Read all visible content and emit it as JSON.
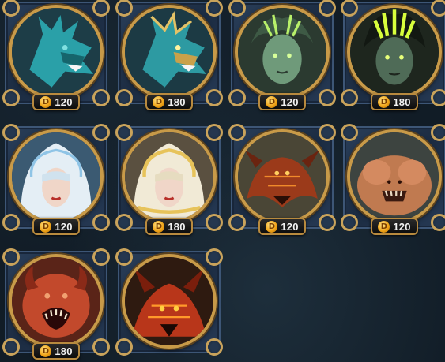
{
  "currency_icon": "gold-coin-icon",
  "currency_symbol": "D",
  "items": [
    {
      "name": "teal-dragon",
      "price": "120",
      "palette": {
        "bg": "#1d3d47",
        "main": "#2aa0a8",
        "accent": "#7fe0e0"
      }
    },
    {
      "name": "teal-gold-dragon",
      "price": "180",
      "palette": {
        "bg": "#1c3a44",
        "main": "#2d9aa2",
        "accent": "#e3c266"
      }
    },
    {
      "name": "green-medusa",
      "price": "120",
      "palette": {
        "bg": "#2b3a30",
        "main": "#6f9a7a",
        "accent": "#b8f06a"
      }
    },
    {
      "name": "dark-medusa",
      "price": "180",
      "palette": {
        "bg": "#1e261e",
        "main": "#4f6b57",
        "accent": "#d8ff3c"
      }
    },
    {
      "name": "white-hooded-priestess",
      "price": "120",
      "palette": {
        "bg": "#3b5a72",
        "main": "#e4eef5",
        "accent": "#8fc4e6"
      }
    },
    {
      "name": "gold-hooded-priestess",
      "price": "180",
      "palette": {
        "bg": "#5a5040",
        "main": "#f1ead6",
        "accent": "#e7c35a"
      }
    },
    {
      "name": "lava-beast",
      "price": "120",
      "palette": {
        "bg": "#4a4636",
        "main": "#9b3a1a",
        "accent": "#f08a2a"
      }
    },
    {
      "name": "flesh-golem",
      "price": "120",
      "palette": {
        "bg": "#3d4440",
        "main": "#c07a50",
        "accent": "#e8a878"
      }
    },
    {
      "name": "red-fiend",
      "price": "180",
      "palette": {
        "bg": "#5a2418",
        "main": "#c2492c",
        "accent": "#f0a070"
      }
    },
    {
      "name": "fire-demon",
      "price": "",
      "palette": {
        "bg": "#2e1a10",
        "main": "#b8361a",
        "accent": "#ff9a2a"
      }
    }
  ]
}
